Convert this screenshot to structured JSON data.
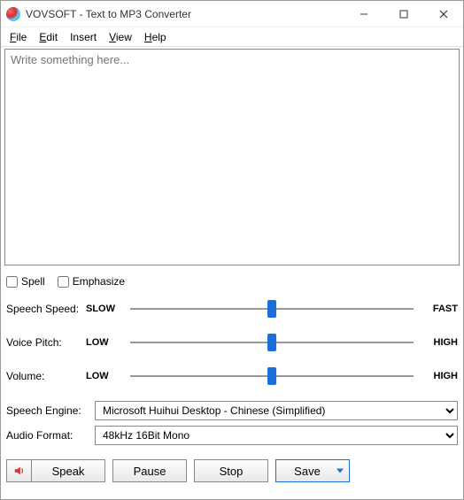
{
  "window": {
    "title": "VOVSOFT - Text to MP3 Converter"
  },
  "menubar": {
    "file": "File",
    "edit": "Edit",
    "insert": "Insert",
    "view": "View",
    "help": "Help"
  },
  "textarea": {
    "placeholder": "Write something here...",
    "value": ""
  },
  "checkboxes": {
    "spell": "Spell",
    "emphasize": "Emphasize"
  },
  "sliders": {
    "speed": {
      "label": "Speech Speed:",
      "min": "SLOW",
      "max": "FAST",
      "pos": 50
    },
    "pitch": {
      "label": "Voice Pitch:",
      "min": "LOW",
      "max": "HIGH",
      "pos": 50
    },
    "volume": {
      "label": "Volume:",
      "min": "LOW",
      "max": "HIGH",
      "pos": 50
    }
  },
  "combos": {
    "engine": {
      "label": "Speech Engine:",
      "value": "Microsoft Huihui Desktop - Chinese (Simplified)"
    },
    "format": {
      "label": "Audio Format:",
      "value": "48kHz 16Bit Mono"
    }
  },
  "buttons": {
    "speak": "Speak",
    "pause": "Pause",
    "stop": "Stop",
    "save": "Save"
  }
}
